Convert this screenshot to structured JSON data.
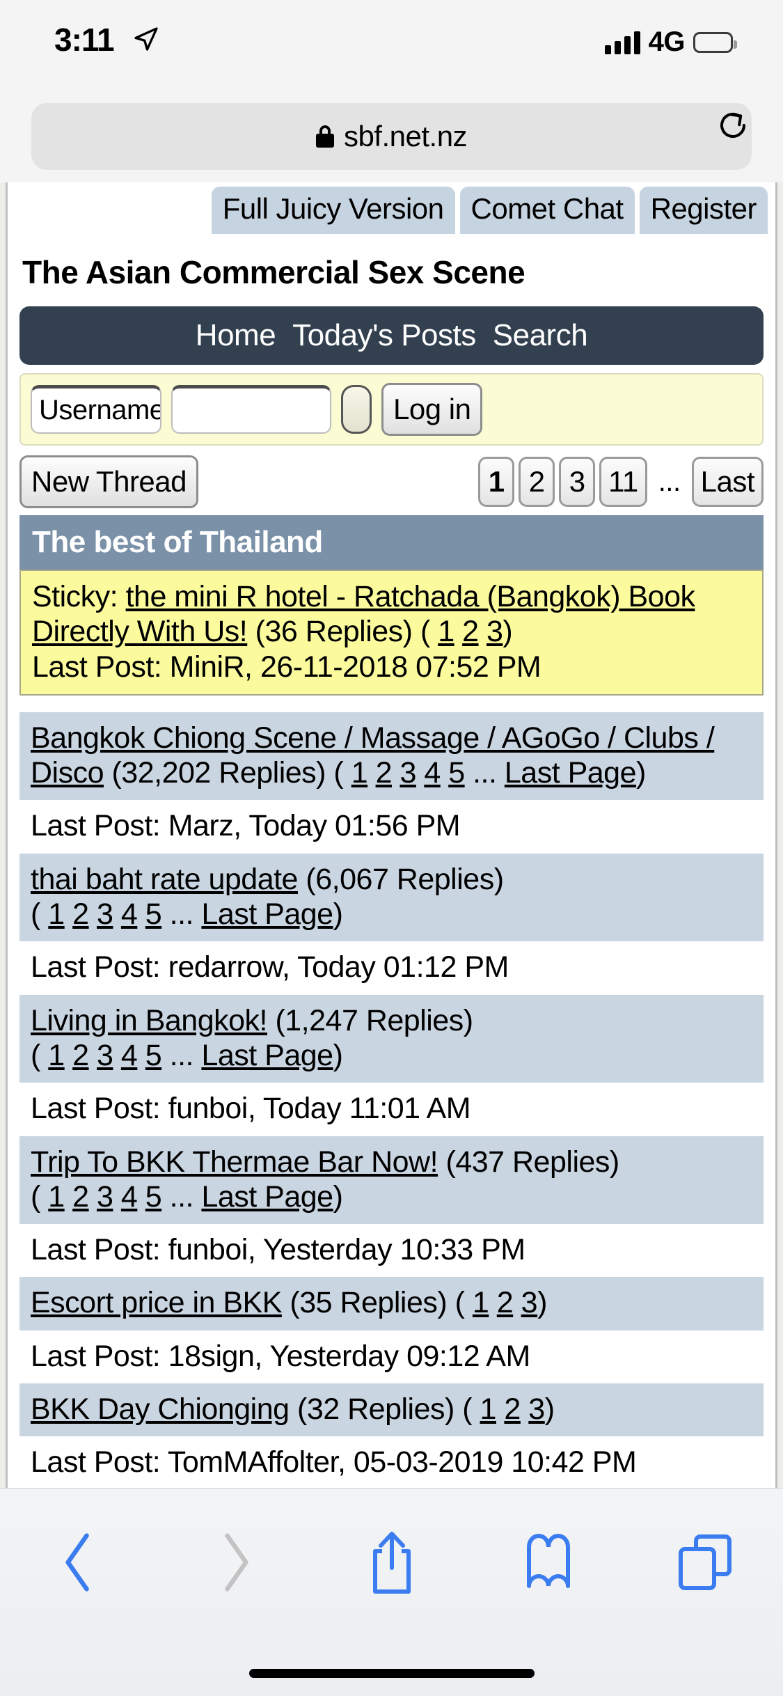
{
  "status_bar": {
    "time": "3:11",
    "location_icon": "location-arrow-icon",
    "signal_icon": "cellular-bars-icon",
    "network": "4G",
    "battery_icon": "battery-icon"
  },
  "browser": {
    "lock_icon": "lock-icon",
    "url": "sbf.net.nz",
    "reload_icon": "reload-icon",
    "toolbar": {
      "back_icon": "chevron-left-icon",
      "forward_icon": "chevron-right-icon",
      "share_icon": "share-icon",
      "bookmarks_icon": "book-icon",
      "tabs_icon": "tabs-icon",
      "home_indicator": "home-indicator"
    }
  },
  "site": {
    "tabs": [
      {
        "label": "Full Juicy Version"
      },
      {
        "label": "Comet Chat"
      },
      {
        "label": "Register"
      }
    ],
    "title": "The Asian Commercial Sex Scene",
    "nav": [
      {
        "label": "Home"
      },
      {
        "label": "Today's Posts"
      },
      {
        "label": "Search"
      }
    ],
    "login": {
      "username_value": "Username",
      "password_value": "",
      "remember_toggle": "remember-me-toggle",
      "login_label": "Log in"
    },
    "actions": {
      "new_thread_label": "New Thread",
      "pages": [
        {
          "label": "1",
          "current": true
        },
        {
          "label": "2",
          "current": false
        },
        {
          "label": "3",
          "current": false
        },
        {
          "label": "11",
          "current": false
        },
        {
          "label": "...",
          "current": false
        },
        {
          "label": "Last",
          "current": false
        }
      ]
    },
    "section_header": "The best of Thailand",
    "sticky": {
      "prefix": "Sticky: ",
      "link": "the mini R hotel - Ratchada (Bangkok) Book Directly With Us!",
      "replies": " (36 Replies) ( ",
      "pages": [
        "1",
        "2",
        "3"
      ],
      "pages_suffix": ")",
      "last_post": "Last Post: MiniR, 26-11-2018 07:52 PM"
    },
    "threads": [
      {
        "title": "Bangkok Chiong Scene / Massage / AGoGo / Clubs / Disco",
        "replies": " (32,202 Replies) ( ",
        "pages": [
          "1",
          "2",
          "3",
          "4",
          "5"
        ],
        "ellipsis": " ... ",
        "last_page": "Last Page",
        "suffix": ")",
        "last_post": "Last Post: Marz, Today 01:56 PM"
      },
      {
        "title": "thai baht rate update",
        "replies": " (6,067 Replies)",
        "break": true,
        "pages_prefix": "( ",
        "pages": [
          "1",
          "2",
          "3",
          "4",
          "5"
        ],
        "ellipsis": " ... ",
        "last_page": "Last Page",
        "suffix": ")",
        "last_post": "Last Post: redarrow, Today 01:12 PM"
      },
      {
        "title": "Living in Bangkok!",
        "replies": " (1,247 Replies)",
        "break": true,
        "pages_prefix": "( ",
        "pages": [
          "1",
          "2",
          "3",
          "4",
          "5"
        ],
        "ellipsis": " ... ",
        "last_page": "Last Page",
        "suffix": ")",
        "last_post": "Last Post: funboi, Today 11:01 AM"
      },
      {
        "title": "Trip To BKK Thermae Bar Now!",
        "replies": " (437 Replies)",
        "break": true,
        "pages_prefix": "( ",
        "pages": [
          "1",
          "2",
          "3",
          "4",
          "5"
        ],
        "ellipsis": " ... ",
        "last_page": "Last Page",
        "suffix": ")",
        "last_post": "Last Post: funboi, Yesterday 10:33 PM"
      },
      {
        "title": "Escort price in BKK",
        "replies": " (35 Replies) ( ",
        "pages": [
          "1",
          "2",
          "3"
        ],
        "suffix": ")",
        "last_post": "Last Post: 18sign, Yesterday 09:12 AM"
      },
      {
        "title": "BKK Day Chionging",
        "replies": " (32 Replies) ( ",
        "pages": [
          "1",
          "2",
          "3"
        ],
        "suffix": ")",
        "last_post": "Last Post: TomMAffolter, 05-03-2019 10:42 PM"
      }
    ]
  },
  "colors": {
    "nav_bar": "#32404f",
    "section_header": "#7b91a8",
    "thread_row": "#c9d5e1",
    "sticky_bg": "#fbfb9e",
    "login_bg": "#fbfbd4",
    "tab_bg": "#c6d3e0",
    "safari_blue": "#3b7cf0"
  }
}
